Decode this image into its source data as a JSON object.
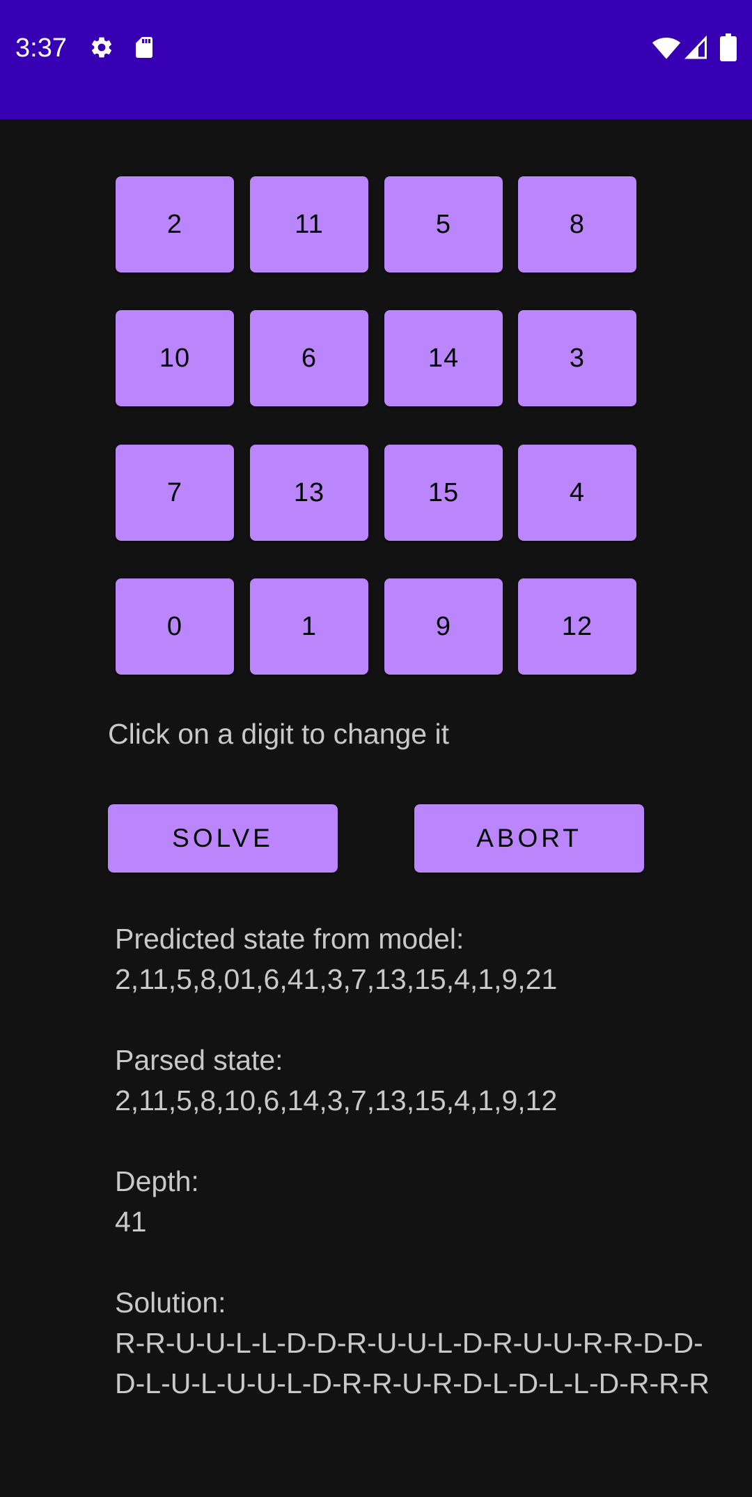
{
  "status_bar": {
    "time": "3:37",
    "left_icons": [
      "gear-icon",
      "sd-card-icon"
    ],
    "right_icons": [
      "wifi-icon",
      "cell-signal-icon",
      "battery-icon"
    ],
    "background": "#3700B3"
  },
  "puzzle": {
    "tiles": [
      "2",
      "11",
      "5",
      "8",
      "10",
      "6",
      "14",
      "3",
      "7",
      "13",
      "15",
      "4",
      "0",
      "1",
      "9",
      "12"
    ],
    "tile_color": "#BB86FC"
  },
  "hint": "Click on a digit to change it",
  "buttons": {
    "solve": "SOLVE",
    "abort": "ABORT"
  },
  "results": {
    "predicted_label": "Predicted state from model:",
    "predicted_value": "2,11,5,8,01,6,41,3,7,13,15,4,1,9,21",
    "parsed_label": "Parsed state:",
    "parsed_value": "2,11,5,8,10,6,14,3,7,13,15,4,1,9,12",
    "depth_label": "Depth:",
    "depth_value": "41",
    "solution_label": "Solution:",
    "solution_line1": "R-R-U-U-L-L-D-D-R-U-U-L-D-R-U-U-R-R-D-D-",
    "solution_line2": "D-L-U-L-U-U-L-D-R-R-U-R-D-L-D-L-L-D-R-R-R"
  }
}
